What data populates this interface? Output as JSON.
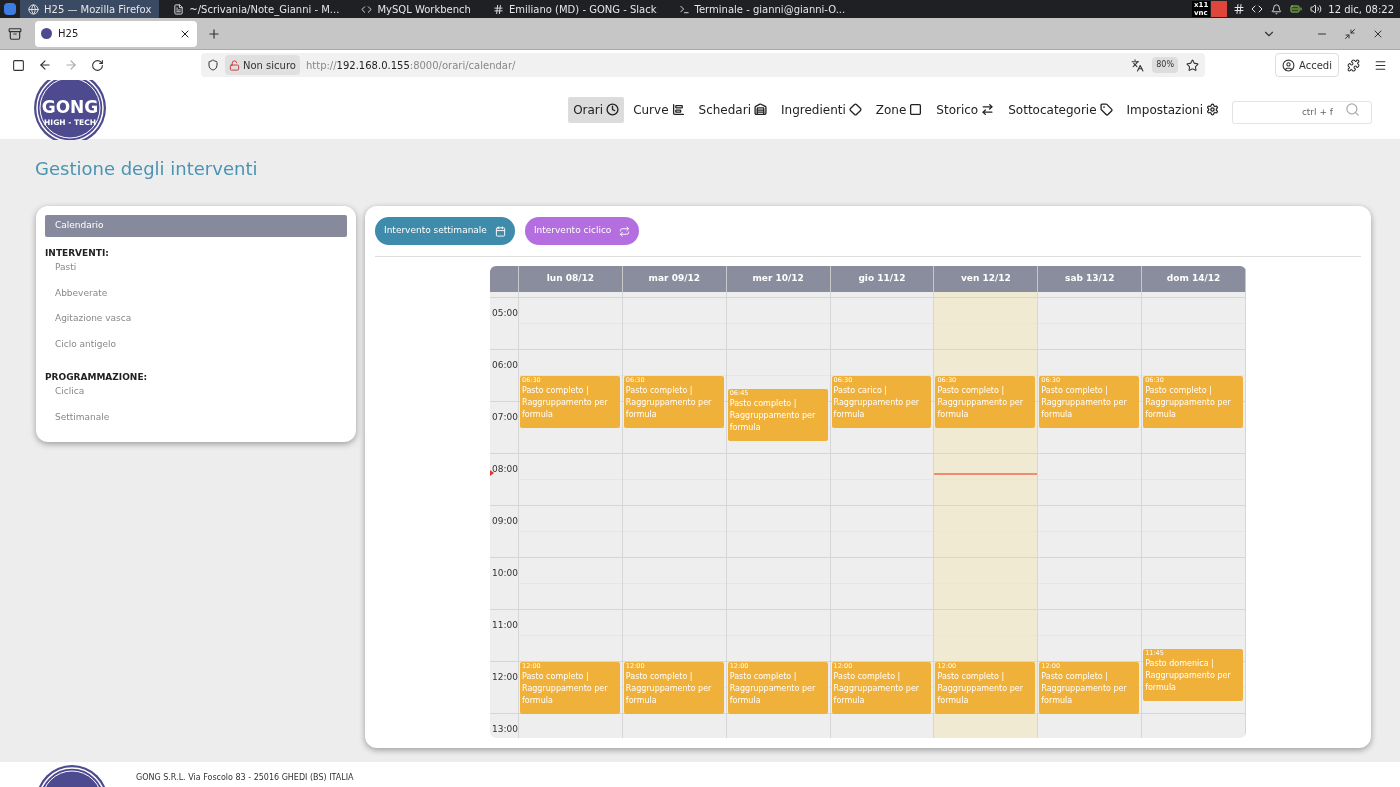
{
  "taskbar": {
    "apps": [
      {
        "label": "H25 — Mozilla Firefox",
        "selected": true
      },
      {
        "label": "~/Scrivania/Note_Gianni - M...",
        "selected": false
      },
      {
        "label": "MySQL Workbench",
        "selected": false
      },
      {
        "label": "Emiliano (MD) - GONG - Slack",
        "selected": false
      },
      {
        "label": "Terminale - gianni@gianni-O...",
        "selected": false
      }
    ],
    "tray_badge": [
      "x11",
      "vnc"
    ],
    "clock": "12 dic, 08:22"
  },
  "browser": {
    "tab_title": "H25",
    "security": "Non sicuro",
    "url_scheme": "http://",
    "url_host": "192.168.0.155",
    "url_rest": ":8000/orari/calendar/",
    "zoom": "80%",
    "account": "Accedi"
  },
  "header": {
    "logo": {
      "name": "GONG",
      "tagline": "HIGH - TECH"
    },
    "nav": [
      {
        "label": "Orari",
        "selected": true
      },
      {
        "label": "Curve",
        "selected": false
      },
      {
        "label": "Schedari",
        "selected": false
      },
      {
        "label": "Ingredienti",
        "selected": false
      },
      {
        "label": "Zone",
        "selected": false
      },
      {
        "label": "Storico",
        "selected": false
      },
      {
        "label": "Sottocategorie",
        "selected": false
      },
      {
        "label": "Impostazioni",
        "selected": false
      }
    ],
    "search": {
      "placeholder": "ctrl + f"
    }
  },
  "page_title": "Gestione degli interventi",
  "footer": "GONG S.R.L. Via Foscolo 83 - 25016 GHEDI (BS) ITALIA",
  "sidebar": {
    "top": {
      "label": "Calendario",
      "selected": true
    },
    "sections": [
      {
        "title": "INTERVENTI:",
        "items": [
          "Pasti",
          "Abbeverate",
          "Agitazione vasca",
          "Ciclo antigelo"
        ]
      },
      {
        "title": "PROGRAMMAZIONE:",
        "items": [
          "Ciclica",
          "Settimanale"
        ]
      }
    ]
  },
  "actions": [
    {
      "label": "Intervento settimanale",
      "color": "#3e8bab"
    },
    {
      "label": "Intervento ciclico",
      "color": "#b46ee0"
    }
  ],
  "calendar": {
    "hours": [
      "05:00",
      "06:00",
      "07:00",
      "08:00",
      "09:00",
      "10:00",
      "11:00",
      "12:00",
      "13:00"
    ],
    "days": [
      {
        "label": "lun 08/12",
        "today": false,
        "events": [
          {
            "time": "06:30",
            "title": "Pasto completo | Raggruppamento per formula"
          },
          {
            "time": "12:00",
            "title": "Pasto completo | Raggruppamento per formula"
          }
        ]
      },
      {
        "label": "mar 09/12",
        "today": false,
        "events": [
          {
            "time": "06:30",
            "title": "Pasto completo | Raggruppamento per formula"
          },
          {
            "time": "12:00",
            "title": "Pasto completo | Raggruppamento per formula"
          }
        ]
      },
      {
        "label": "mer 10/12",
        "today": false,
        "events": [
          {
            "time": "06:45",
            "title": "Pasto completo | Raggruppamento per formula"
          },
          {
            "time": "12:00",
            "title": "Pasto completo | Raggruppamento per formula"
          }
        ]
      },
      {
        "label": "gio 11/12",
        "today": false,
        "events": [
          {
            "time": "06:30",
            "title": "Pasto carico | Raggruppamento per formula"
          },
          {
            "time": "12:00",
            "title": "Pasto completo | Raggruppamento per formula"
          }
        ]
      },
      {
        "label": "ven 12/12",
        "today": true,
        "events": [
          {
            "time": "06:30",
            "title": "Pasto completo | Raggruppamento per formula"
          },
          {
            "time": "12:00",
            "title": "Pasto completo | Raggruppamento per formula"
          }
        ]
      },
      {
        "label": "sab 13/12",
        "today": false,
        "events": [
          {
            "time": "06:30",
            "title": "Pasto completo | Raggruppamento per formula"
          },
          {
            "time": "12:00",
            "title": "Pasto completo | Raggruppamento per formula"
          }
        ]
      },
      {
        "label": "dom 14/12",
        "today": false,
        "events": [
          {
            "time": "06:30",
            "title": "Pasto completo | Raggruppamento per formula"
          },
          {
            "time": "11:45",
            "title": "Pasto domenica | Raggruppamento per formula"
          }
        ]
      }
    ]
  }
}
